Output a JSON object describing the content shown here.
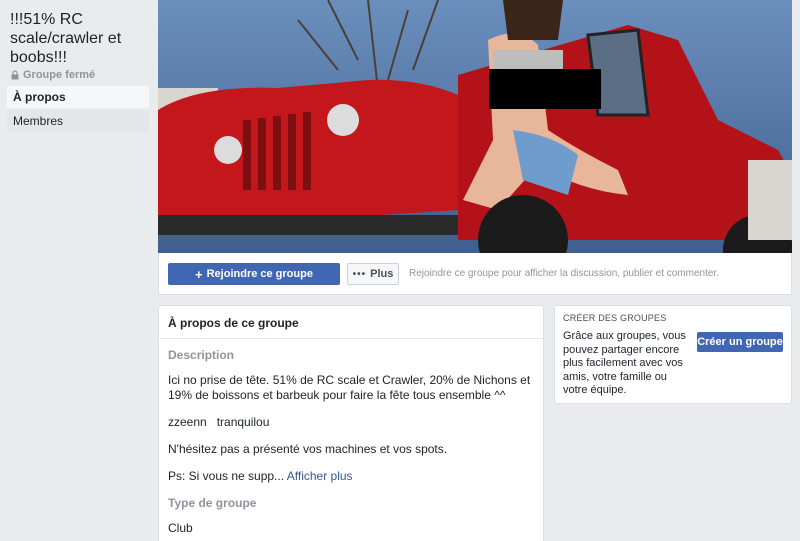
{
  "group": {
    "title": "!!!51% RC scale/crawler et boobs!!!",
    "status": "Groupe fermé"
  },
  "nav": {
    "about": "À propos",
    "members": "Membres"
  },
  "actions": {
    "join": "Rejoindre ce groupe",
    "more": "Plus",
    "hint": "Rejoindre ce groupe pour afficher la discussion, publier et commenter."
  },
  "about": {
    "header": "À propos de ce groupe",
    "description_label": "Description",
    "para1": "Ici no prise de tête. 51% de RC scale et Crawler, 20% de Nichons et 19% de boissons et barbeuk pour faire la fête tous ensemble ^^",
    "para2": "zzeenn   tranquilou",
    "para3": "N'hésitez pas a présenté vos machines et vos spots.",
    "para4_prefix": "Ps: Si vous ne supp...",
    "para4_link": "Afficher plus",
    "type_label": "Type de groupe",
    "type_value": "Club"
  },
  "create": {
    "title": "CRÉER DES GROUPES",
    "text": "Grâce aux groupes, vous pouvez partager encore plus facilement avec vos amis, votre famille ou votre équipe.",
    "button": "Créer un groupe"
  },
  "colors": {
    "brand": "#4267b2",
    "link": "#365899",
    "page_bg": "#e9ebee"
  }
}
